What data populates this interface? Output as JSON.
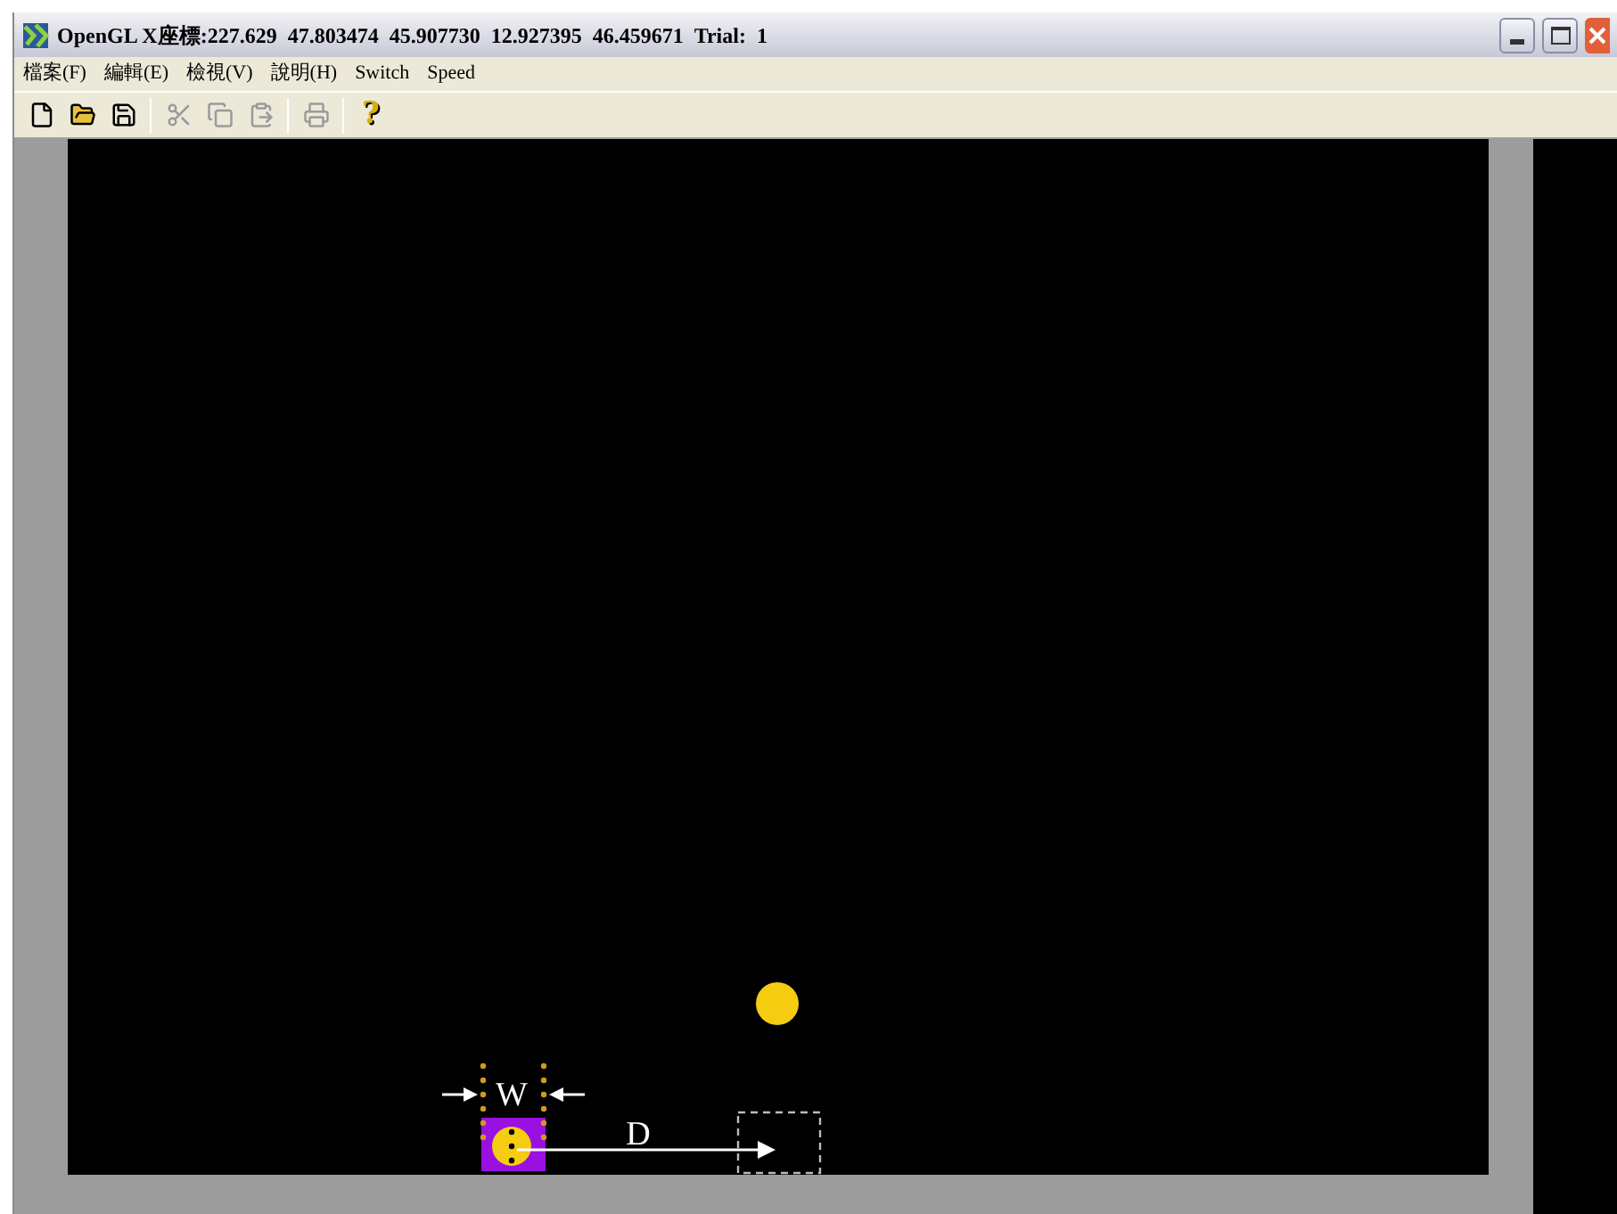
{
  "window": {
    "title": "OpenGL X座標:227.629  47.803474  45.907730  12.927395  46.459671  Trial:  1"
  },
  "menu": [
    "檔案(F)",
    "編輯(E)",
    "檢視(V)",
    "說明(H)",
    "Switch",
    "Speed"
  ],
  "toolbar": [
    {
      "kind": "new",
      "disabled": false
    },
    {
      "kind": "open",
      "disabled": false
    },
    {
      "kind": "save",
      "disabled": false
    },
    {
      "kind": "sep"
    },
    {
      "kind": "cut",
      "disabled": true
    },
    {
      "kind": "copy",
      "disabled": true
    },
    {
      "kind": "paste",
      "disabled": true
    },
    {
      "kind": "sep"
    },
    {
      "kind": "print",
      "disabled": true
    },
    {
      "kind": "sep"
    },
    {
      "kind": "help",
      "disabled": false,
      "glyph": "?"
    }
  ],
  "canvas": {
    "width_label": "W",
    "distance_label": "D"
  }
}
